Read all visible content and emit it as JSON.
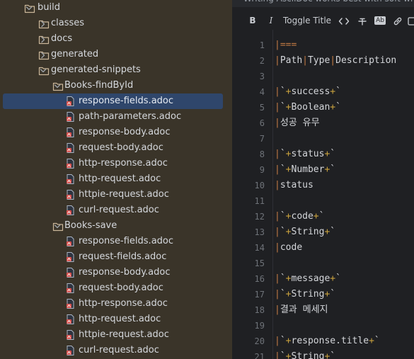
{
  "project_tree": {
    "items": [
      {
        "label": "build",
        "depth": 0,
        "expanded": true,
        "kind": "folder"
      },
      {
        "label": "classes",
        "depth": 1,
        "expanded": false,
        "kind": "folder"
      },
      {
        "label": "docs",
        "depth": 1,
        "expanded": false,
        "kind": "folder"
      },
      {
        "label": "generated",
        "depth": 1,
        "expanded": false,
        "kind": "folder"
      },
      {
        "label": "generated-snippets",
        "depth": 1,
        "expanded": true,
        "kind": "folder"
      },
      {
        "label": "Books-findById",
        "depth": 2,
        "expanded": true,
        "kind": "folder"
      },
      {
        "label": "response-fields.adoc",
        "depth": 3,
        "kind": "file",
        "selected": true
      },
      {
        "label": "path-parameters.adoc",
        "depth": 3,
        "kind": "file"
      },
      {
        "label": "response-body.adoc",
        "depth": 3,
        "kind": "file"
      },
      {
        "label": "request-body.adoc",
        "depth": 3,
        "kind": "file"
      },
      {
        "label": "http-response.adoc",
        "depth": 3,
        "kind": "file"
      },
      {
        "label": "http-request.adoc",
        "depth": 3,
        "kind": "file"
      },
      {
        "label": "httpie-request.adoc",
        "depth": 3,
        "kind": "file"
      },
      {
        "label": "curl-request.adoc",
        "depth": 3,
        "kind": "file"
      },
      {
        "label": "Books-save",
        "depth": 2,
        "expanded": true,
        "kind": "folder"
      },
      {
        "label": "response-fields.adoc",
        "depth": 3,
        "kind": "file"
      },
      {
        "label": "request-fields.adoc",
        "depth": 3,
        "kind": "file"
      },
      {
        "label": "response-body.adoc",
        "depth": 3,
        "kind": "file"
      },
      {
        "label": "request-body.adoc",
        "depth": 3,
        "kind": "file"
      },
      {
        "label": "http-response.adoc",
        "depth": 3,
        "kind": "file"
      },
      {
        "label": "http-request.adoc",
        "depth": 3,
        "kind": "file"
      },
      {
        "label": "httpie-request.adoc",
        "depth": 3,
        "kind": "file"
      },
      {
        "label": "curl-request.adoc",
        "depth": 3,
        "kind": "file"
      }
    ]
  },
  "editor": {
    "banner_text": "Writing AsciiDoc works best with soft-wrap",
    "toolbar": {
      "bold": "B",
      "italic": "I",
      "toggle_title": "Toggle Title",
      "code_icon": "code-brackets-icon",
      "strike_icon": "strikethrough-icon",
      "mono": "Ab",
      "link_icon": "link-icon"
    },
    "lines": [
      {
        "n": "1",
        "text": "|==="
      },
      {
        "n": "2",
        "text": "|Path|Type|Description"
      },
      {
        "n": "3",
        "text": ""
      },
      {
        "n": "4",
        "text": "|`+success+`"
      },
      {
        "n": "5",
        "text": "|`+Boolean+`"
      },
      {
        "n": "6",
        "text": "|성공 유무"
      },
      {
        "n": "7",
        "text": ""
      },
      {
        "n": "8",
        "text": "|`+status+`"
      },
      {
        "n": "9",
        "text": "|`+Number+`"
      },
      {
        "n": "10",
        "text": "|status"
      },
      {
        "n": "11",
        "text": ""
      },
      {
        "n": "12",
        "text": "|`+code+`"
      },
      {
        "n": "13",
        "text": "|`+String+`"
      },
      {
        "n": "14",
        "text": "|code"
      },
      {
        "n": "15",
        "text": ""
      },
      {
        "n": "16",
        "text": "|`+message+`"
      },
      {
        "n": "17",
        "text": "|`+String+`"
      },
      {
        "n": "18",
        "text": "|결과 메세지"
      },
      {
        "n": "19",
        "text": ""
      },
      {
        "n": "20",
        "text": "|`+response.title+`"
      },
      {
        "n": "21",
        "text": "|`+String+`"
      }
    ]
  },
  "colors": {
    "tree_bg": "#3a3429",
    "selection": "#2f466b",
    "editor_bg": "#1f2023",
    "pipe": "#c27a43",
    "plus": "#c9a23e"
  }
}
